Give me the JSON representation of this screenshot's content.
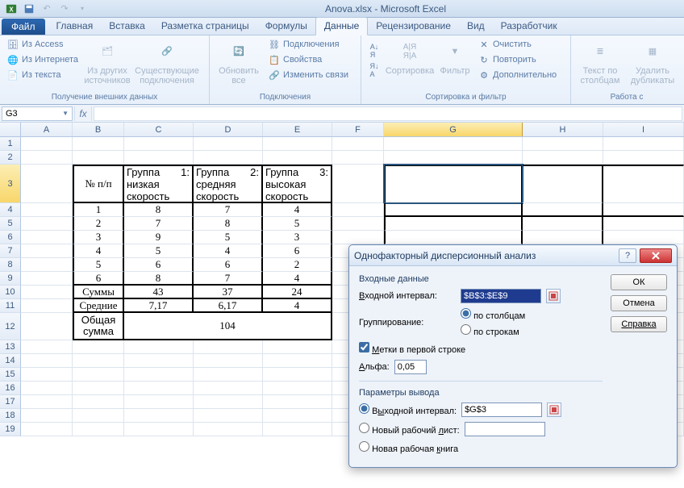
{
  "title": "Anova.xlsx - Microsoft Excel",
  "tabs": {
    "file": "Файл",
    "items": [
      "Главная",
      "Вставка",
      "Разметка страницы",
      "Формулы",
      "Данные",
      "Рецензирование",
      "Вид",
      "Разработчик"
    ],
    "active_index": 4
  },
  "ribbon": {
    "external": {
      "access": "Из Access",
      "web": "Из Интернета",
      "text": "Из текста",
      "other": "Из других источников",
      "existing": "Существующие подключения",
      "group": "Получение внешних данных"
    },
    "connections": {
      "refresh": "Обновить все",
      "conns": "Подключения",
      "props": "Свойства",
      "links": "Изменить связи",
      "group": "Подключения"
    },
    "sortfilter": {
      "sort": "Сортировка",
      "filter": "Фильтр",
      "clear": "Очистить",
      "reapply": "Повторить",
      "advanced": "Дополнительно",
      "group": "Сортировка и фильтр"
    },
    "tools": {
      "texttocols": "Текст по столбцам",
      "dedup": "Удалить дубликаты",
      "group": "Работа с"
    }
  },
  "namebox": "G3",
  "columns": [
    "A",
    "B",
    "C",
    "D",
    "E",
    "F",
    "G",
    "H",
    "I"
  ],
  "rownums": [
    "1",
    "2",
    "3",
    "4",
    "5",
    "6",
    "7",
    "8",
    "9",
    "10",
    "11",
    "12",
    "13",
    "14",
    "15",
    "16",
    "17",
    "18",
    "19"
  ],
  "table": {
    "h_num": "№  п/п",
    "h1a": "Группа",
    "h1b": "1:",
    "h1c": "низкая скорость",
    "h2a": "Группа",
    "h2b": "2:",
    "h2c": "средняя скорость",
    "h3a": "Группа",
    "h3b": "3:",
    "h3c": "высокая скорость",
    "data": [
      [
        "1",
        "8",
        "7",
        "4"
      ],
      [
        "2",
        "7",
        "8",
        "5"
      ],
      [
        "3",
        "9",
        "5",
        "3"
      ],
      [
        "4",
        "5",
        "4",
        "6"
      ],
      [
        "5",
        "6",
        "6",
        "2"
      ],
      [
        "6",
        "8",
        "7",
        "4"
      ]
    ],
    "sums_label": "Суммы",
    "sums": [
      "43",
      "37",
      "24"
    ],
    "means_label": "Средние",
    "means": [
      "7,17",
      "6,17",
      "4"
    ],
    "total_label_a": "Общая",
    "total_label_b": "сумма",
    "total": "104"
  },
  "dialog": {
    "title": "Однофакторный дисперсионный анализ",
    "input_section": "Входные данные",
    "input_range_label": "Входной интервал:",
    "input_range_u": "В",
    "input_range": "$B$3:$E$9",
    "grouping_label": "Группирование:",
    "by_cols": "по столбцам",
    "by_rows": "по строкам",
    "labels_check_u": "М",
    "labels_check": "етки в первой строке",
    "alpha_label_u": "А",
    "alpha_label": "льфа:",
    "alpha": "0,05",
    "output_section": "Параметры вывода",
    "out_range_u": "ы",
    "out_range_label_pre": "В",
    "out_range_label_post": "ходной интервал:",
    "out_range": "$G$3",
    "new_sheet_label": "Новый рабочий ",
    "new_sheet_u": "л",
    "new_sheet_post": "ист:",
    "new_book_label": "Новая рабочая ",
    "new_book_u": "к",
    "new_book_post": "нига",
    "ok": "ОК",
    "cancel": "Отмена",
    "help": "Справка"
  }
}
